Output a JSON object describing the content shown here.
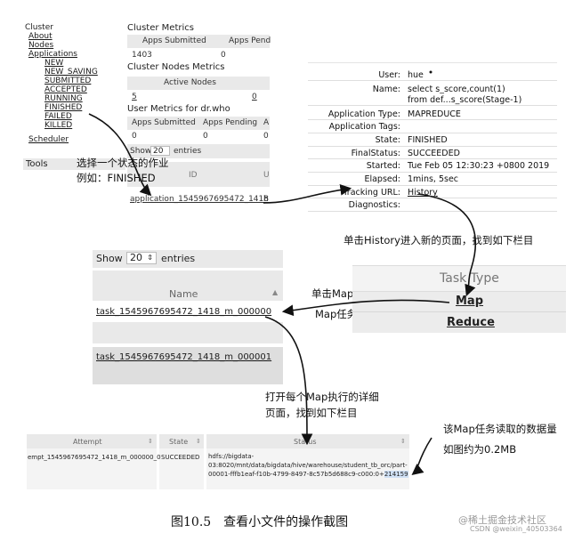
{
  "panel1": {
    "nav": {
      "cluster": "Cluster",
      "about": "About",
      "nodes": "Nodes",
      "applications": "Applications",
      "states": [
        "NEW",
        "NEW_SAVING",
        "SUBMITTED",
        "ACCEPTED",
        "RUNNING",
        "FINISHED",
        "FAILED",
        "KILLED"
      ],
      "scheduler": "Scheduler",
      "tools": "Tools"
    },
    "cluster_metrics": {
      "title": "Cluster Metrics",
      "col1": "Apps Submitted",
      "col2": "Apps Pend",
      "val1": "1403",
      "val2": "0"
    },
    "nodes_metrics": {
      "title": "Cluster Nodes Metrics",
      "col1": "Active Nodes",
      "val1": "5",
      "val2": "0"
    },
    "user_metrics": {
      "title": "User Metrics for dr.who",
      "col1": "Apps Submitted",
      "col2": "Apps Pending",
      "col3": "A",
      "v1": "0",
      "v2": "0",
      "v3": "0"
    },
    "show": "Show",
    "show_count": "20",
    "entries": "entries",
    "id_header": "ID",
    "u_header": "U",
    "app_link": "application_1545967695472_1418",
    "h_cut": "h"
  },
  "annot1": {
    "line1": "选择一个状态的作业",
    "line2": "例如：FINISHED"
  },
  "panel2": {
    "rows": [
      {
        "label": "User:",
        "value": "hue"
      },
      {
        "label": "Name:",
        "value": "select s_score,count(1)",
        "value2": "from def...s_score(Stage-1)"
      },
      {
        "label": "Application Type:",
        "value": "MAPREDUCE"
      },
      {
        "label": "Application Tags:",
        "value": ""
      },
      {
        "label": "State:",
        "value": "FINISHED"
      },
      {
        "label": "FinalStatus:",
        "value": "SUCCEEDED"
      },
      {
        "label": "Started:",
        "value": "Tue Feb 05 12:30:23 +0800 2019"
      },
      {
        "label": "Elapsed:",
        "value": "1mins, 5sec"
      },
      {
        "label": "Tracking URL:",
        "value": "History"
      },
      {
        "label": "Diagnostics:",
        "value": ""
      }
    ]
  },
  "annot2": "单击History进入新的页面，找到如下栏目",
  "panel3": {
    "show": "Show",
    "count": "20",
    "entries": "entries",
    "name_header": "Name",
    "task1": "task_1545967695472_1418_m_000000",
    "task2": "task_1545967695472_1418_m_000001"
  },
  "annot3": {
    "line1": "单击Map，进入",
    "line2": "Map任务的启动列表"
  },
  "panel4": {
    "header": "Task Type",
    "map": "Map",
    "reduce": "Reduce"
  },
  "annot4": {
    "line1": "打开每个Map执行的详细",
    "line2": "页面，找到如下栏目"
  },
  "annot5": {
    "line1": "该Map任务读取的数据量",
    "line2": "如图约为0.2MB"
  },
  "panel5": {
    "attempt_header": "Attempt",
    "state_header": "State",
    "status_header": "Status",
    "attempt": "empt_1545967695472_1418_m_000000_0",
    "state": "SUCCEEDED",
    "status_lines": [
      "hdfs://bigdata-",
      "03:8020/mnt/data/bigdata/hive/warehouse/student_tb_orc/part-",
      "00001-fffb1eaf-f10b-4799-8497-8c57b5d688c9-c000:0+"
    ],
    "status_size": "214159"
  },
  "caption": "图10.5　查看小文件的操作截图",
  "watermark1": "@稀土掘金技术社区",
  "watermark2": "CSDN @weixin_40503364",
  "colors": {
    "accent_bg": "#ececec",
    "ink": "#111111"
  }
}
